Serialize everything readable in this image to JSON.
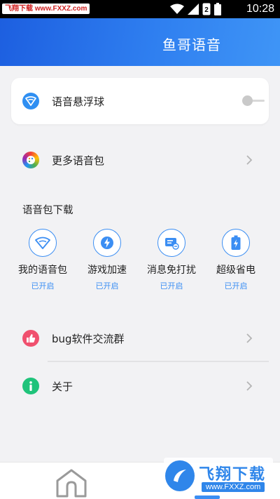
{
  "status_bar": {
    "watermark_text": "飞翔下载 www.FXXZ.com",
    "time": "10:28",
    "icons": [
      "wifi-icon",
      "signal-icon",
      "sim-badge-icon",
      "battery-icon"
    ]
  },
  "header": {
    "title": "鱼哥语音"
  },
  "floating_ball": {
    "label": "语音悬浮球",
    "icon": "wifi-shield-icon",
    "toggle_on": false
  },
  "more_packs": {
    "label": "更多语音包",
    "icon": "palette-icon"
  },
  "downloads": {
    "title": "语音包下载",
    "items": [
      {
        "name": "我的语音包",
        "status": "已开启",
        "icon": "wifi-diamond-icon"
      },
      {
        "name": "游戏加速",
        "status": "已开启",
        "icon": "lightning-icon"
      },
      {
        "name": "消息免打扰",
        "status": "已开启",
        "icon": "message-mute-icon"
      },
      {
        "name": "超级省电",
        "status": "已开启",
        "icon": "battery-bolt-icon"
      }
    ]
  },
  "bug_group": {
    "label": "bug软件交流群",
    "icon": "thumbs-up-icon"
  },
  "about": {
    "label": "关于",
    "icon": "info-icon"
  },
  "bottom_nav": {
    "active_index": 1
  },
  "watermark": {
    "name": "飞翔下载",
    "url": "www.FXXZ.com"
  },
  "colors": {
    "primary": "#3b8ef3",
    "header_start": "#1d5fe0",
    "header_end": "#3f95f6",
    "bug_icon": "#f0506e",
    "about_icon": "#1fc37a"
  }
}
